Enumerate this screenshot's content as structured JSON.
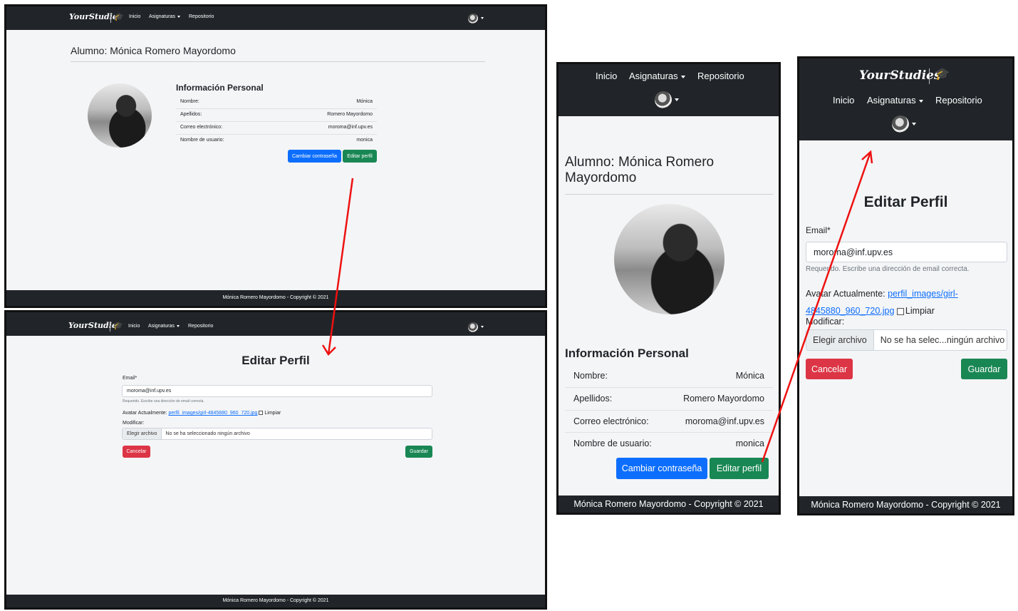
{
  "brand": "YourStudies",
  "nav": {
    "home": "Inicio",
    "subjects": "Asignaturas",
    "repo": "Repositorio"
  },
  "footer": "Mónica Romero Mayordomo - Copyright © 2021",
  "profile": {
    "title": "Alumno: Mónica Romero Mayordomo",
    "title_line1": "Alumno: Mónica Romero",
    "title_line2": "Mayordomo",
    "section": "Información Personal",
    "rows": [
      {
        "label": "Nombre:",
        "value": "Mónica"
      },
      {
        "label": "Apellidos:",
        "value": "Romero Mayordomo"
      },
      {
        "label": "Correo electrónico:",
        "value": "moroma@inf.upv.es"
      },
      {
        "label": "Nombre de usuario:",
        "value": "monica"
      }
    ],
    "change_password": "Cambiar contraseña",
    "edit_profile": "Editar perfil"
  },
  "edit": {
    "title": "Editar Perfil",
    "email_label": "Email*",
    "email_value": "moroma@inf.upv.es",
    "help": "Requerido. Escribe una dirección de email correcta.",
    "help_m1": "Reque",
    "help_m2": "do. Escribe una dirección de email correcta.",
    "avatar_label": "Avatar Actualmente:",
    "avatar_link": "perfil_images/girl-4845880_960_720.jpg",
    "avatar_m1": "Av",
    "avatar_m2": "ar Actualmente:",
    "avatar_link_m1": "perfil_images/girl-",
    "avatar_link_m2": "4845880_960_720.jpg",
    "email_m1": "moro",
    "email_m2": "ma@inf.upv.es",
    "modify_m": "odificar:",
    "clear": "Limpiar",
    "modify": "Modificar:",
    "choose": "Elegir archivo",
    "no_file": "No se ha seleccionado ningún archivo",
    "no_file_short": "No se ha selec...ningún archivo",
    "cancel": "Cancelar",
    "save": "Guardar"
  },
  "colors": {
    "arrow": "#ee1111",
    "navbar": "#212529",
    "primary": "#0d6efd",
    "success": "#198754",
    "danger": "#dc3545"
  }
}
